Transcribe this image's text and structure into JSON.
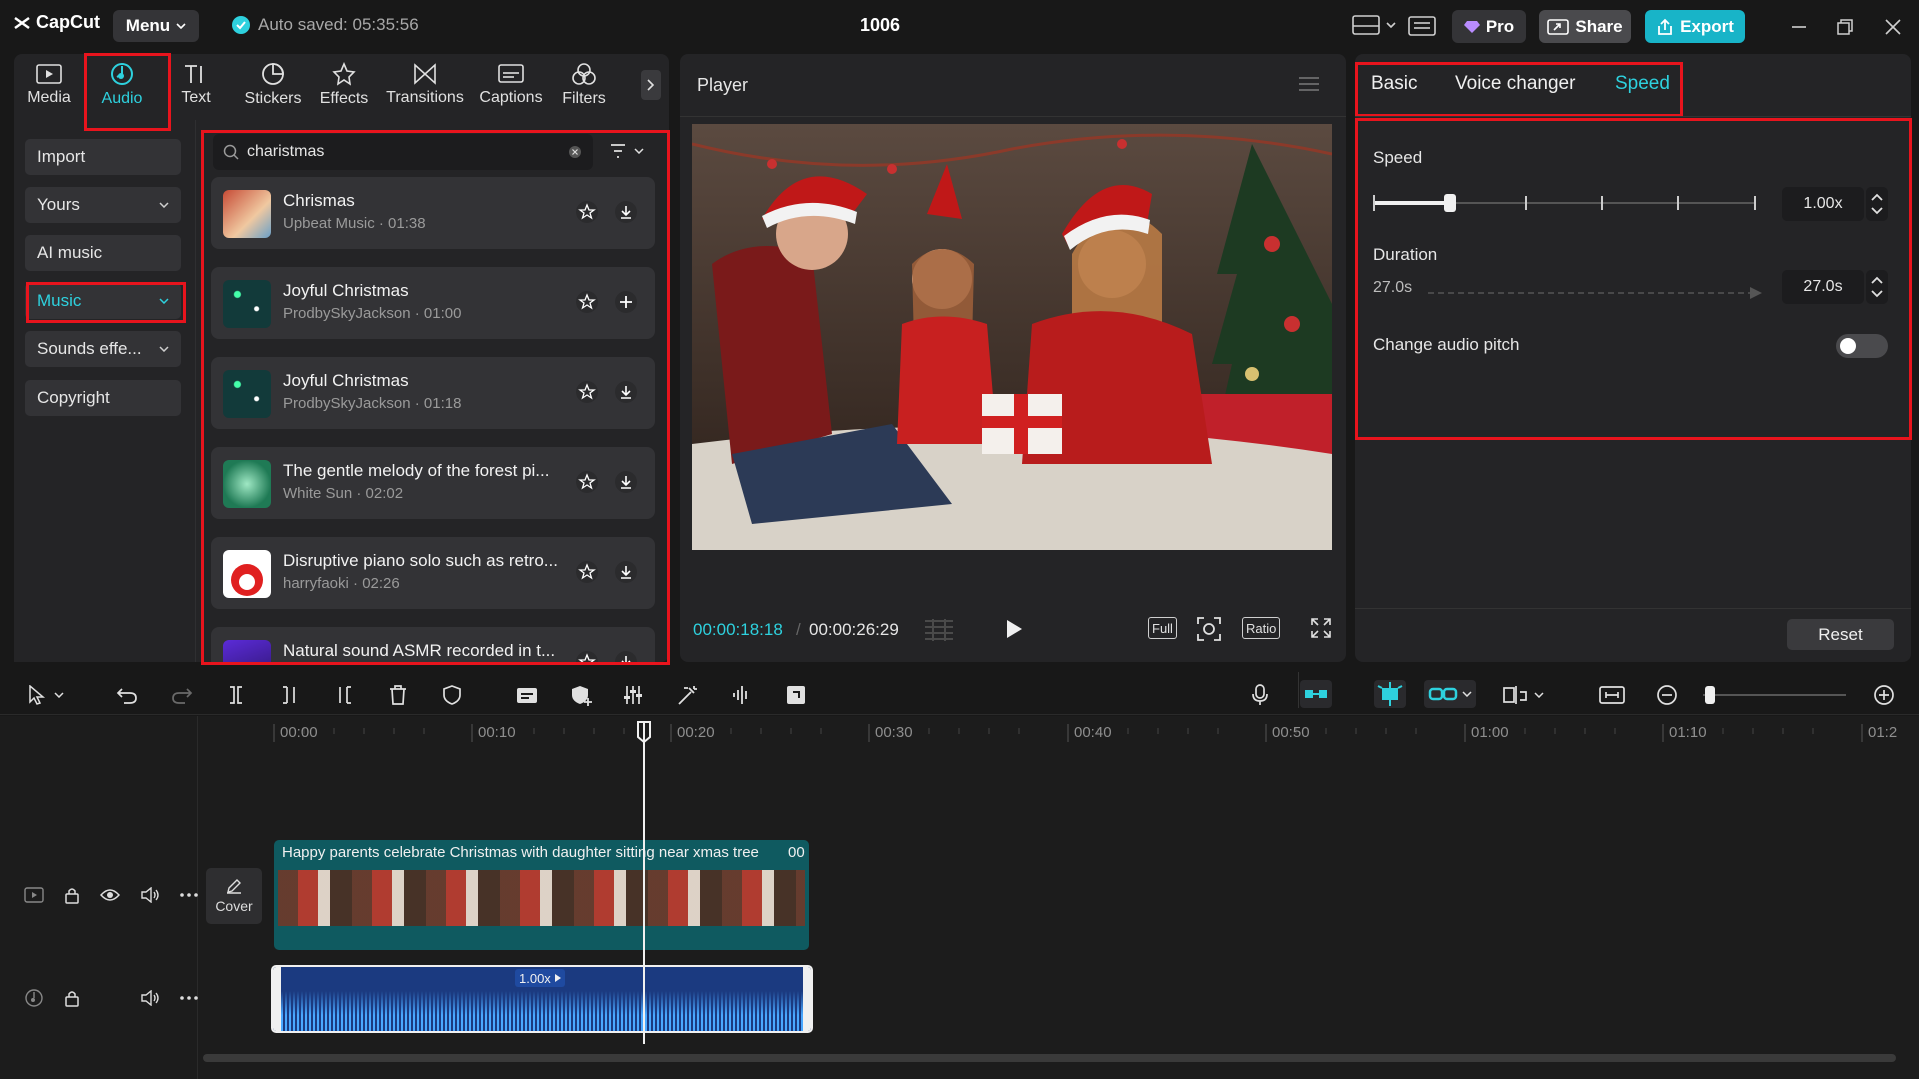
{
  "app": {
    "name": "CapCut",
    "menu_label": "Menu",
    "autosave": "Auto saved: 05:35:56",
    "project_title": "1006"
  },
  "topbar": {
    "pro_label": "Pro",
    "share_label": "Share",
    "export_label": "Export"
  },
  "tools": {
    "tabs": [
      {
        "label": "Media",
        "icon": "media-icon"
      },
      {
        "label": "Audio",
        "icon": "audio-icon",
        "active": true
      },
      {
        "label": "Text",
        "icon": "text-icon"
      },
      {
        "label": "Stickers",
        "icon": "stickers-icon"
      },
      {
        "label": "Effects",
        "icon": "effects-icon"
      },
      {
        "label": "Transitions",
        "icon": "transitions-icon"
      },
      {
        "label": "Captions",
        "icon": "captions-icon"
      },
      {
        "label": "Filters",
        "icon": "filters-icon"
      }
    ]
  },
  "sidebar": {
    "items": [
      {
        "label": "Import"
      },
      {
        "label": "Yours"
      },
      {
        "label": "AI music"
      },
      {
        "label": "Music"
      },
      {
        "label": "Sounds effe..."
      },
      {
        "label": "Copyright"
      }
    ]
  },
  "search": {
    "value": "charistmas"
  },
  "music_list": [
    {
      "title": "Chrismas",
      "meta": "Upbeat Music · 01:38",
      "action": "download"
    },
    {
      "title": "Joyful Christmas",
      "meta": "ProdbySkyJackson · 01:00",
      "action": "add"
    },
    {
      "title": "Joyful Christmas",
      "meta": "ProdbySkyJackson · 01:18",
      "action": "download"
    },
    {
      "title": "The gentle melody of the forest pi...",
      "meta": "White Sun · 02:02",
      "action": "download"
    },
    {
      "title": "Disruptive piano solo such as retro...",
      "meta": "harryfaoki · 02:26",
      "action": "download"
    },
    {
      "title": "Natural sound ASMR recorded in t...",
      "meta": "",
      "action": "download"
    }
  ],
  "player": {
    "title": "Player",
    "current_time": "00:00:18:18",
    "total_time": "00:00:26:29",
    "full_label": "Full",
    "ratio_label": "Ratio"
  },
  "right_panel": {
    "tabs": [
      "Basic",
      "Voice changer",
      "Speed"
    ],
    "active_tab": "Speed",
    "speed_label": "Speed",
    "speed_value": "1.00x",
    "speed_slider_fraction": 0.2,
    "duration_label": "Duration",
    "duration_original": "27.0s",
    "duration_value": "27.0s",
    "pitch_label": "Change audio pitch",
    "pitch_enabled": false,
    "reset_label": "Reset"
  },
  "timeline": {
    "ruler": [
      "00:00",
      "00:10",
      "00:20",
      "00:30",
      "00:40",
      "00:50",
      "01:00",
      "01:10",
      "01:2"
    ],
    "video_clip_title": "Happy parents celebrate Christmas with daughter sitting near xmas tree",
    "video_clip_time": "00",
    "cover_label": "Cover",
    "audio_clip_speed": "1.00x"
  },
  "colors": {
    "accent": "#2ed1de",
    "highlight": "#e8141d",
    "panel": "#242426",
    "export": "#18b4c8"
  }
}
